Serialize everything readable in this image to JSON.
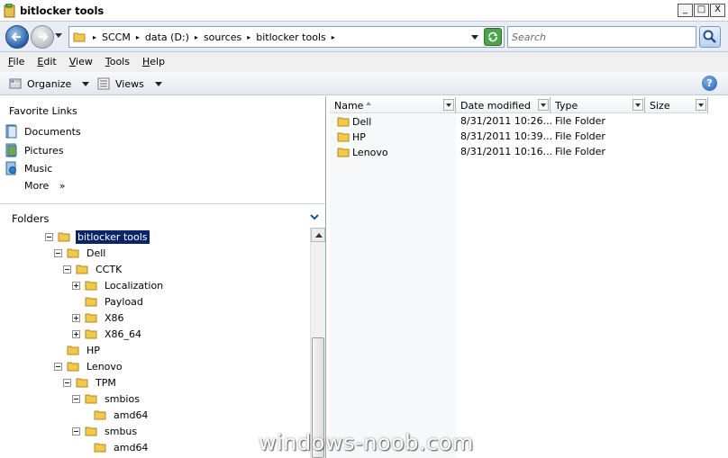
{
  "window": {
    "title": "bitlocker tools",
    "controls": [
      "_",
      "□",
      "X"
    ]
  },
  "address": {
    "crumbs": [
      "SCCM",
      "data (D:)",
      "sources",
      "bitlocker tools"
    ],
    "search_placeholder": "Search"
  },
  "menu": {
    "items": [
      {
        "key": "F",
        "rest": "ile"
      },
      {
        "key": "E",
        "rest": "dit"
      },
      {
        "key": "V",
        "rest": "iew"
      },
      {
        "key": "T",
        "rest": "ools"
      },
      {
        "key": "H",
        "rest": "elp"
      }
    ]
  },
  "toolbar": {
    "organize_label": "Organize",
    "views_label": "Views",
    "help_glyph": "?"
  },
  "favorites": {
    "title": "Favorite Links",
    "items": [
      {
        "label": "Documents",
        "icon": "documents-icon"
      },
      {
        "label": "Pictures",
        "icon": "pictures-icon"
      },
      {
        "label": "Music",
        "icon": "music-icon"
      }
    ],
    "more_label": "More",
    "more_glyph": "»"
  },
  "folders": {
    "title": "Folders",
    "tree": [
      {
        "label": "bitlocker tools",
        "level": 0,
        "expander": "minus",
        "selected": true
      },
      {
        "label": "Dell",
        "level": 1,
        "expander": "minus"
      },
      {
        "label": "CCTK",
        "level": 2,
        "expander": "minus"
      },
      {
        "label": "Localization",
        "level": 3,
        "expander": "plus"
      },
      {
        "label": "Payload",
        "level": 3,
        "expander": "none"
      },
      {
        "label": "X86",
        "level": 3,
        "expander": "plus"
      },
      {
        "label": "X86_64",
        "level": 3,
        "expander": "plus"
      },
      {
        "label": "HP",
        "level": 1,
        "expander": "none"
      },
      {
        "label": "Lenovo",
        "level": 1,
        "expander": "minus"
      },
      {
        "label": "TPM",
        "level": 2,
        "expander": "minus"
      },
      {
        "label": "smbios",
        "level": 3,
        "expander": "minus"
      },
      {
        "label": "amd64",
        "level": 4,
        "expander": "none"
      },
      {
        "label": "smbus",
        "level": 3,
        "expander": "minus"
      },
      {
        "label": "amd64",
        "level": 4,
        "expander": "none"
      }
    ]
  },
  "filelist": {
    "columns": [
      "Name",
      "Date modified",
      "Type",
      "Size"
    ],
    "rows": [
      {
        "name": "Dell",
        "date": "8/31/2011 10:26...",
        "type": "File Folder",
        "size": ""
      },
      {
        "name": "HP",
        "date": "8/31/2011 10:39...",
        "type": "File Folder",
        "size": ""
      },
      {
        "name": "Lenovo",
        "date": "8/31/2011 10:16...",
        "type": "File Folder",
        "size": ""
      }
    ]
  },
  "watermark": "windows-noob.com",
  "colors": {
    "selection": "#0a246a",
    "folder_yellow": "#f2c94c"
  }
}
